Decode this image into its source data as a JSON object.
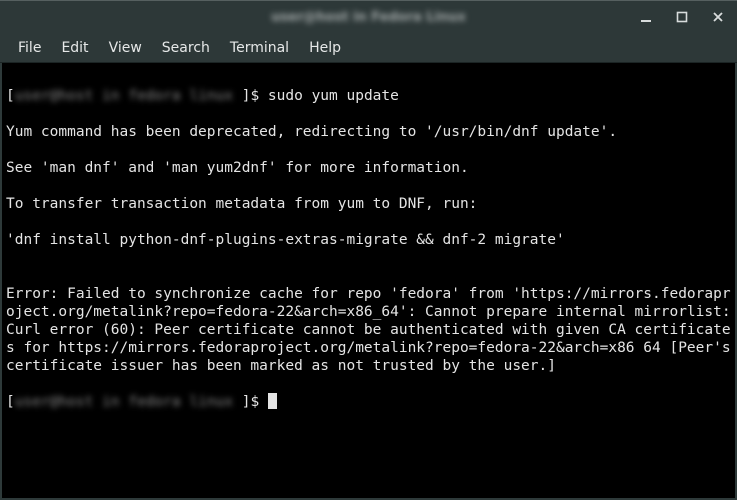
{
  "window": {
    "title": "user@host in Fedora Linux"
  },
  "menu": {
    "file": "File",
    "edit": "Edit",
    "view": "View",
    "search": "Search",
    "terminal": "Terminal",
    "help": "Help"
  },
  "prompt": {
    "open": "[",
    "obscured": "user@host in fedora linux ",
    "close": "]$ "
  },
  "terminal_lines": {
    "cmd": "sudo yum update",
    "l1": "Yum command has been deprecated, redirecting to '/usr/bin/dnf update'.",
    "l2": "See 'man dnf' and 'man yum2dnf' for more information.",
    "l3": "To transfer transaction metadata from yum to DNF, run:",
    "l4": "'dnf install python-dnf-plugins-extras-migrate && dnf-2 migrate'",
    "l5": "",
    "l6": "Error: Failed to synchronize cache for repo 'fedora' from 'https://mirrors.fedoraproject.org/metalink?repo=fedora-22&arch=x86_64': Cannot prepare internal mirrorlist: Curl error (60): Peer certificate cannot be authenticated with given CA certificates for https://mirrors.fedoraproject.org/metalink?repo=fedora-22&arch=x86 64 [Peer's certificate issuer has been marked as not trusted by the user.]"
  }
}
